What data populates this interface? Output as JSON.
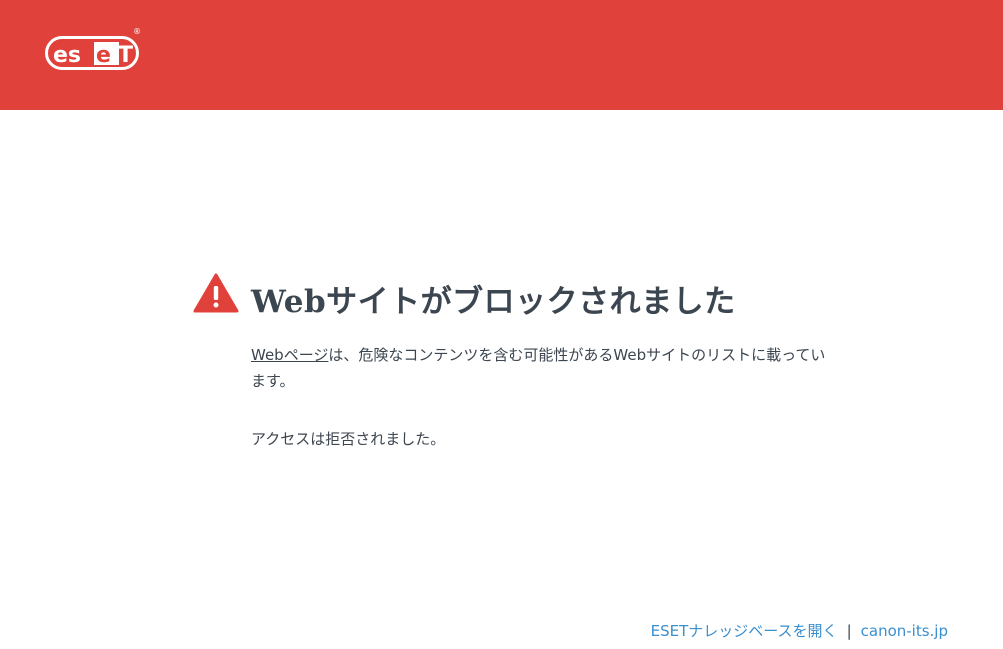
{
  "brand": {
    "logo_text": "ESET",
    "header_color": "#e0423b"
  },
  "main": {
    "title": "Webサイトがブロックされました",
    "description_link": "Webページ",
    "description_rest": "は、危険なコンテンツを含む可能性があるWebサイトのリストに載っています。",
    "access_denied": "アクセスは拒否されました。",
    "warning_icon": "warning-triangle-icon"
  },
  "footer": {
    "knowledge_base_link": "ESETナレッジベースを開く",
    "separator": "|",
    "site_link": "canon-its.jp",
    "link_color": "#3a8fcf"
  }
}
